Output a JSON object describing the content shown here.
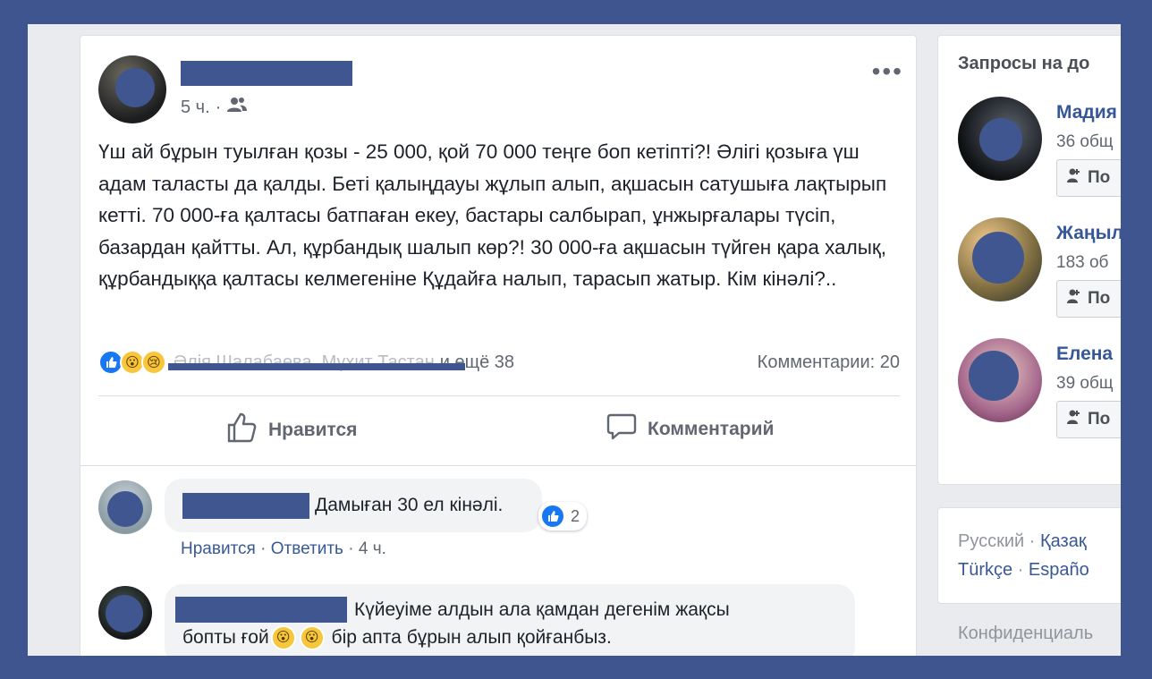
{
  "post": {
    "time": "5 ч.",
    "audience_icon": "friends-icon",
    "more_icon": "more-dots-icon",
    "more_label": "•••",
    "text": "Үш ай бұрын туылған қозы - 25 000, қой 70 000 теңге боп кетіпті?! Әлігі қозыға үш адам таласты да қалды. Беті қалыңдауы жұлып алып, ақшасын сатушыға лақтырып кетті. 70 000-ға қалтасы батпаған екеу, бастары салбырап, ұнжырғалары түсіп, базардан қайтты. Ал, құрбандық шалып көр?! 30 000-ға ақшасын түйген қара халық, құрбандыққа қалтасы келмегеніне Құдайға налып, тарасып жатыр. Кім кінәлі?..",
    "reactions": {
      "types": [
        "like",
        "wow",
        "sad"
      ],
      "names_redacted": "Әлія Шалабаева, Мұхит Тастан",
      "and_more": "и ещё 38",
      "comments_count": "Комментарии: 20"
    },
    "actions": {
      "like_label": "Нравится",
      "comment_label": "Комментарий"
    }
  },
  "comments": [
    {
      "text": "Дамыған 30 ел кінәлі.",
      "reaction_count": "2",
      "like_label": "Нравится",
      "reply_label": "Ответить",
      "time": "4 ч."
    },
    {
      "text_before": "Күйеуіме алдын ала қамдан дегенім жақсы",
      "text_line2_start": "бопты ғой",
      "text_line2_end": " бір апта бұрын алып қойғанбыз."
    }
  ],
  "sidebar": {
    "requests_title": "Запросы на до",
    "requests": [
      {
        "name": "Мадия",
        "mutual": "36 общ",
        "button": "По"
      },
      {
        "name": "Жаңыл",
        "mutual": "183 об",
        "button": "По"
      },
      {
        "name": "Елена",
        "mutual": "39 общ",
        "button": "По"
      }
    ],
    "languages": {
      "line1_current": "Русский",
      "line1_link": "Қазақ",
      "line2_link1": "Türkçe",
      "line2_link2": "Españo"
    },
    "privacy": "Конфиденциаль"
  },
  "colors": {
    "border": "#3e5590",
    "redaction": "#3f5690",
    "link": "#385898",
    "like_blue": "#1877f2"
  }
}
